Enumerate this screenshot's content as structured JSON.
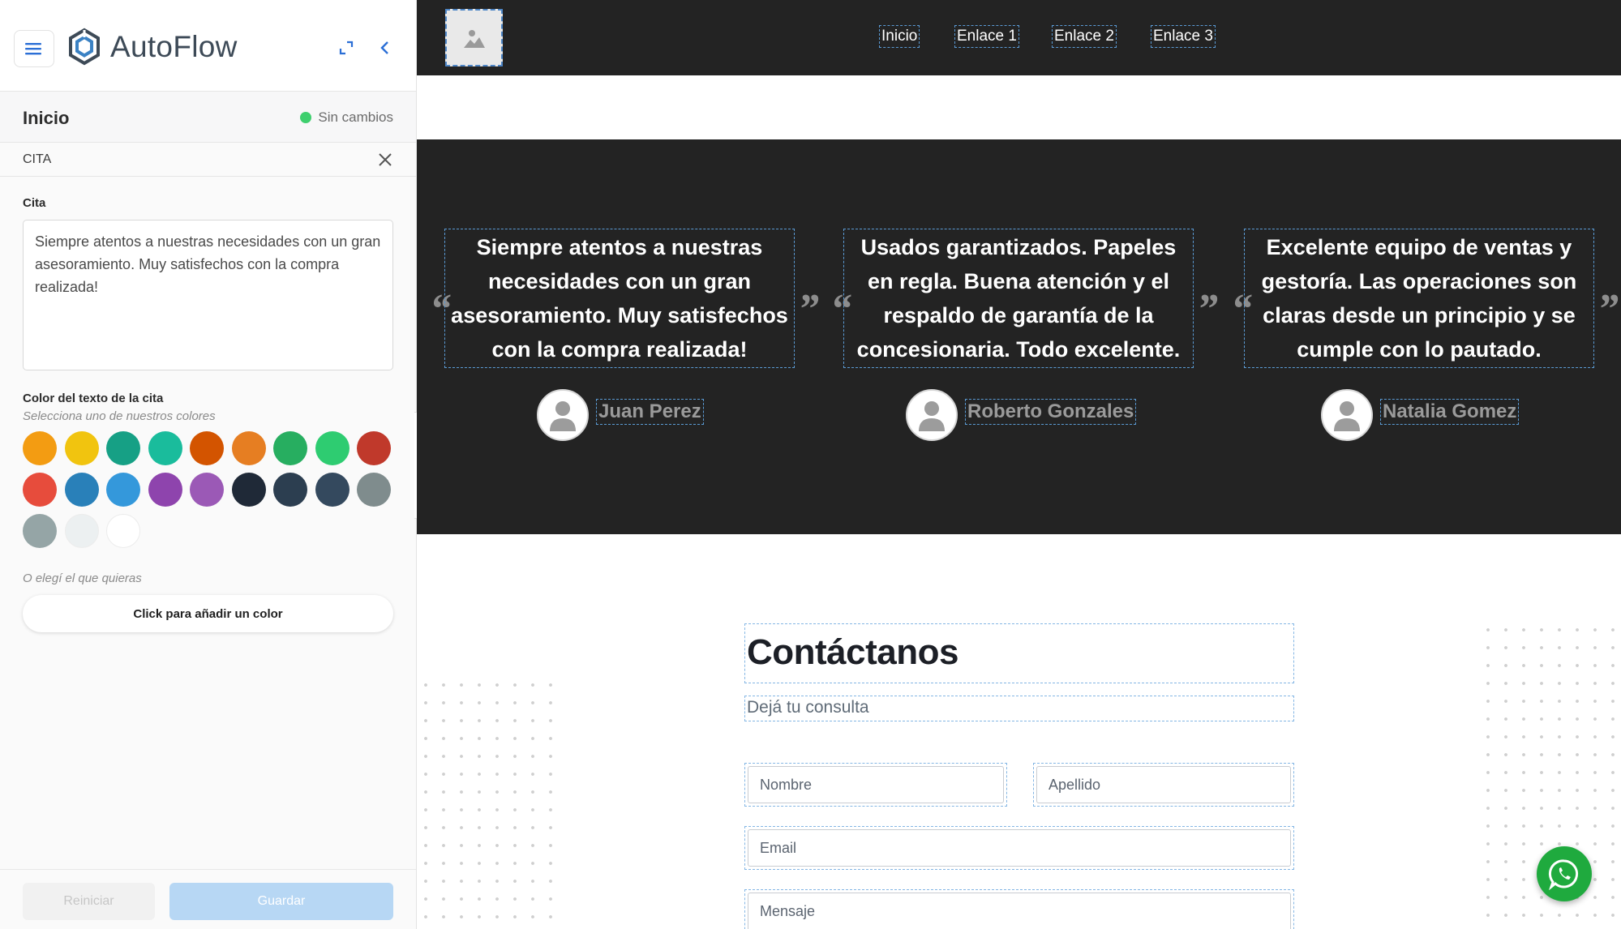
{
  "sidebar": {
    "brand": "AutoFlow",
    "page_title": "Inicio",
    "status": "Sin cambios",
    "section": "CITA",
    "quote_label": "Cita",
    "quote_value": "Siempre atentos a nuestras necesidades con un gran asesoramiento. Muy satisfechos con la compra realizada!",
    "color_label": "Color del texto de la cita",
    "color_hint": "Selecciona uno de nuestros colores",
    "colors": [
      "#f39c12",
      "#f1c40f",
      "#16a085",
      "#1abc9c",
      "#d35400",
      "#e67e22",
      "#27ae60",
      "#2ecc71",
      "#c0392b",
      "#e74c3c",
      "#2980b9",
      "#3498db",
      "#8e44ad",
      "#9b59b6",
      "#1f2937",
      "#2c3e50",
      "#34495e",
      "#7f8c8d",
      "#95a5a6",
      "#ecf0f1",
      "#ffffff"
    ],
    "custom_hint": "O elegí el que quieras",
    "add_color": "Click para añadir un color",
    "reset": "Reiniciar",
    "save": "Guardar"
  },
  "preview": {
    "nav_links": [
      "Inicio",
      "Enlace 1",
      "Enlace 2",
      "Enlace 3"
    ],
    "testimonials": [
      {
        "quote": "Siempre atentos a nuestras necesidades con un gran asesoramiento. Muy satisfechos con la compra realizada!",
        "author": "Juan Perez"
      },
      {
        "quote": "Usados garantizados. Papeles en regla. Buena atención y el respaldo de garantía de la concesionaria. Todo excelente.",
        "author": "Roberto Gonzales"
      },
      {
        "quote": "Excelente equipo de ventas y gestoría. Las operaciones son claras desde un principio y se cumple con lo pautado.",
        "author": "Natalia Gomez"
      }
    ],
    "open_quote": "“",
    "close_quote": "”",
    "contact_title": "Contáctanos",
    "contact_subtitle": "Dejá tu consulta",
    "fields": {
      "first_name": "Nombre",
      "last_name": "Apellido",
      "email": "Email",
      "message": "Mensaje"
    }
  }
}
